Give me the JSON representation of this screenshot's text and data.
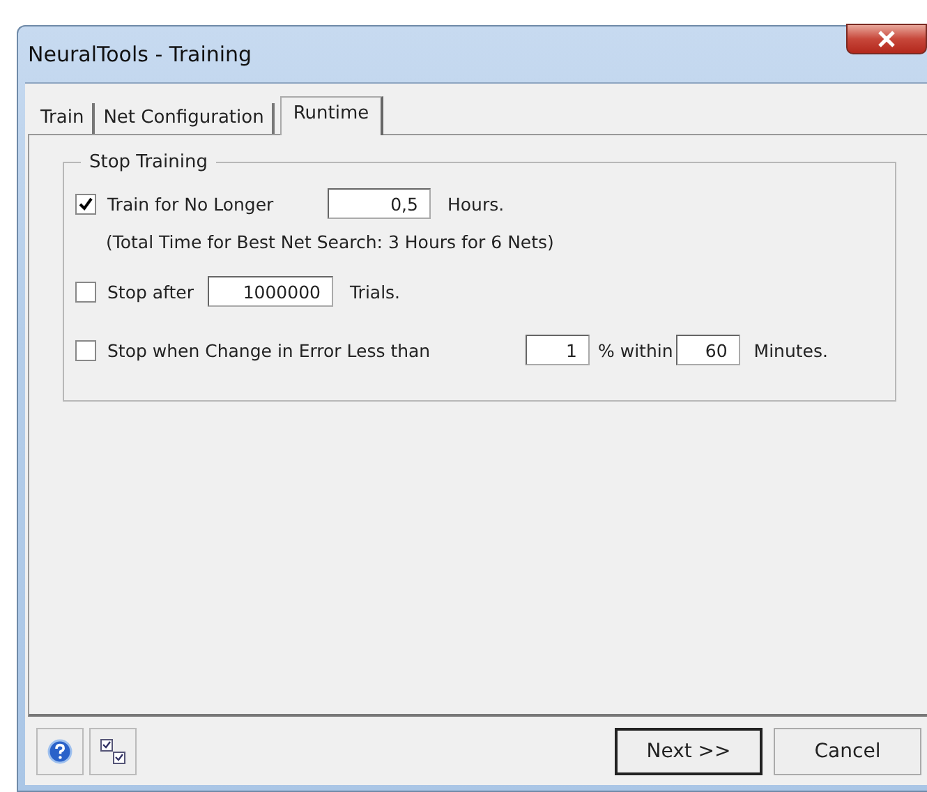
{
  "window": {
    "title": "NeuralTools - Training"
  },
  "tabs": [
    {
      "label": "Train",
      "selected": false
    },
    {
      "label": "Net Configuration",
      "selected": false
    },
    {
      "label": "Runtime",
      "selected": true
    }
  ],
  "group": {
    "title": "Stop Training"
  },
  "options": [
    {
      "kind": "hours",
      "checked": true,
      "label": "Train for No Longer",
      "value": "0,5",
      "unit": "Hours.",
      "note": "(Total Time for Best Net Search: 3 Hours for 6 Nets)"
    },
    {
      "kind": "trials",
      "checked": false,
      "label": "Stop after",
      "value": "1000000",
      "unit": "Trials."
    },
    {
      "kind": "error",
      "checked": false,
      "label": "Stop when Change in Error Less than",
      "value": "1",
      "unit": "% within",
      "value2": "60",
      "unit2": "Minutes."
    }
  ],
  "buttons": [
    {
      "label": "Next >>",
      "default": true
    },
    {
      "label": "Cancel",
      "default": false
    }
  ]
}
